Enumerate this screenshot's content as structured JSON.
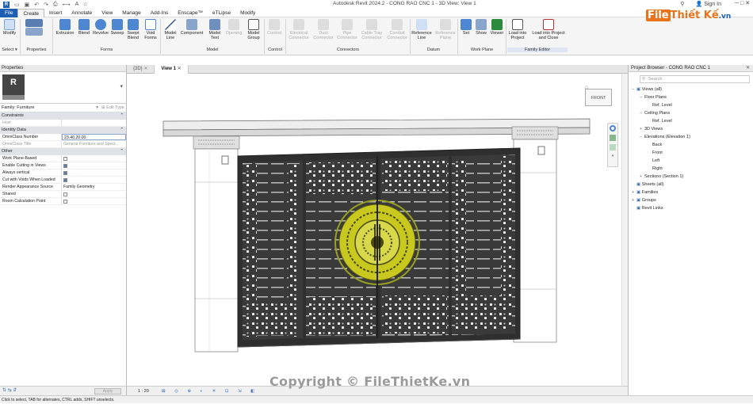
{
  "titlebar": {
    "title": "Autodesk Revit 2024.2 - CONG RAO CNC 1 - 3D View: View 1",
    "sign_in": "Sign In",
    "qat_icons": [
      "open-icon",
      "save-icon",
      "undo-icon",
      "redo-icon",
      "print-icon"
    ]
  },
  "tabs": [
    "File",
    "Create",
    "Insert",
    "Annotate",
    "View",
    "Manage",
    "Add-Ins",
    "Enscape™",
    "eTLipse",
    "Modify"
  ],
  "active_tab": "Create",
  "ribbon": {
    "buttons": {
      "modify": "Modify",
      "extrusion": "Extrusion",
      "blend": "Blend",
      "revolve": "Revolve",
      "sweep": "Sweep",
      "swept_blend": "Swept Blend",
      "void_forms": "Void Forms",
      "model_line": "Model Line",
      "component": "Component",
      "model_text": "Model Text",
      "opening": "Opening",
      "model_group": "Model Group",
      "control": "Control",
      "electrical_connector": "Electrical Connector",
      "duct_connector": "Duct Connector",
      "pipe_connector": "Pipe Connector",
      "cable_tray_connector": "Cable Tray Connector",
      "conduit_connector": "Conduit Connector",
      "reference_line": "Reference Line",
      "reference_plane": "Reference Plane",
      "set": "Set",
      "show": "Show",
      "viewer": "Viewer",
      "load_into_project": "Load into Project",
      "load_into_project_close": "Load into Project and Close"
    },
    "panels": {
      "select": "Select ▾",
      "properties": "Properties",
      "forms": "Forms",
      "model": "Model",
      "control": "Control",
      "connectors": "Connectors",
      "datum": "Datum",
      "work_plane": "Work Plane",
      "family_editor": "Family Editor"
    }
  },
  "properties": {
    "header": "Properties",
    "family_label": "Family: Furniture",
    "edit_type": "Edit Type",
    "constraints_section": "Constraints",
    "host_label": "Host",
    "identity_section": "Identity Data",
    "omniclass_number_label": "OmniClass Number",
    "omniclass_number_value": "23.40.20.00",
    "omniclass_title_label": "OmniClass Title",
    "omniclass_title_value": "General Furniture and Speci...",
    "other_section": "Other",
    "rows": [
      {
        "label": "Work Plane-Based",
        "checked": false
      },
      {
        "label": "Enable Cutting in Views",
        "checked": true
      },
      {
        "label": "Always vertical",
        "checked": true
      },
      {
        "label": "Cut with Voids When Loaded",
        "checked": true
      }
    ],
    "render_label": "Render Appearance Source",
    "render_value": "Family Geometry",
    "shared_label": "Shared",
    "shared_checked": false,
    "room_calc_label": "Room Calculation Point",
    "room_calc_checked": false,
    "apply": "Apply"
  },
  "view_tabs": [
    {
      "label": "{3D}",
      "active": false
    },
    {
      "label": "View 1",
      "active": true
    }
  ],
  "viewcube_label": "FRONT",
  "view_control": {
    "scale": "1 : 20"
  },
  "project_browser": {
    "header": "Project Browser - CONG RAO CNC 1",
    "search_placeholder": "Search",
    "tree": [
      {
        "label": "Views (all)",
        "level": 0,
        "exp": "−"
      },
      {
        "label": "Floor Plans",
        "level": 1,
        "exp": "−"
      },
      {
        "label": "Ref. Level",
        "level": 2,
        "exp": ""
      },
      {
        "label": "Ceiling Plans",
        "level": 1,
        "exp": "−"
      },
      {
        "label": "Ref. Level",
        "level": 2,
        "exp": ""
      },
      {
        "label": "3D Views",
        "level": 1,
        "exp": "+"
      },
      {
        "label": "Elevations (Elevation 1)",
        "level": 1,
        "exp": "−"
      },
      {
        "label": "Back",
        "level": 2,
        "exp": ""
      },
      {
        "label": "Front",
        "level": 2,
        "exp": ""
      },
      {
        "label": "Left",
        "level": 2,
        "exp": ""
      },
      {
        "label": "Right",
        "level": 2,
        "exp": ""
      },
      {
        "label": "Sections (Section 1)",
        "level": 1,
        "exp": "+"
      },
      {
        "label": "Sheets (all)",
        "level": 0,
        "exp": ""
      },
      {
        "label": "Families",
        "level": 0,
        "exp": "+"
      },
      {
        "label": "Groups",
        "level": 0,
        "exp": "+"
      },
      {
        "label": "Revit Links",
        "level": 0,
        "exp": ""
      }
    ]
  },
  "status_text": "Click to select, TAB for alternates, CTRL adds, SHIFT unselects.",
  "watermark": "Copyright © FileThietKe.vn",
  "logo": {
    "part1": "File",
    "part2": "Thiết Kế",
    "part3": ".vn"
  },
  "colors": {
    "file_tab": "#1e5fb4",
    "gate_dark": "#3a3a3a",
    "emblem": "#c8c81e",
    "logo_orange": "#e8731a",
    "logo_blue": "#1a5fb4"
  }
}
